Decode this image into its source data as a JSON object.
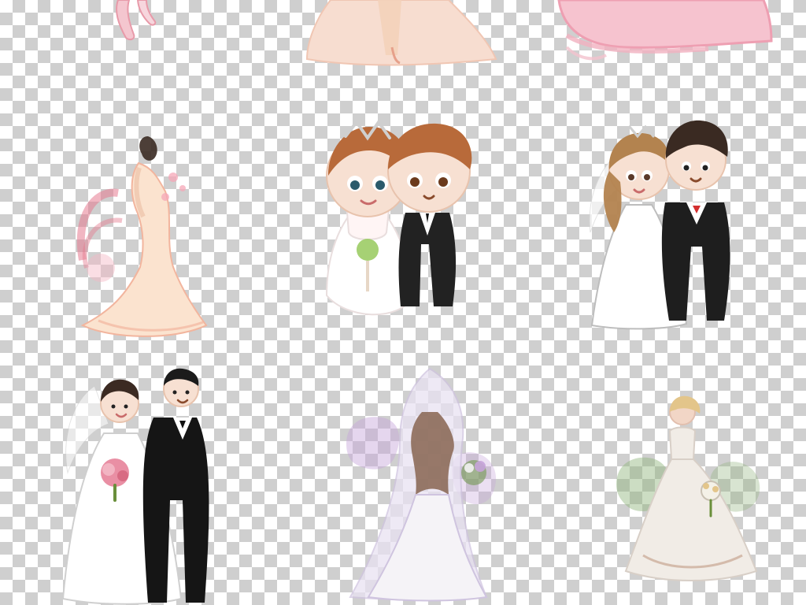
{
  "image": {
    "kind": "clipart-collage",
    "background": "transparency-checkerboard",
    "checker_colors": [
      "#ffffff",
      "#cfcfcf"
    ],
    "rows": 3,
    "figures": [
      {
        "id": "top-left-pink-ribbon-fragment",
        "style": "illustration",
        "palette": [
          "#f4c6cf",
          "#e89aa9"
        ]
      },
      {
        "id": "top-center-peach-gown-fragment",
        "style": "illustration",
        "palette": [
          "#f7ddd0",
          "#f0c6b3"
        ]
      },
      {
        "id": "top-right-pink-ruffle-fragment",
        "style": "illustration",
        "palette": [
          "#f6c3cf",
          "#ee9fb2"
        ]
      },
      {
        "id": "mid-left-bride-peach-gown",
        "style": "illustration",
        "palette": [
          "#fbe3cf",
          "#f2b59e",
          "#e57a8f"
        ]
      },
      {
        "id": "mid-center-chibi-couple",
        "style": "cartoon",
        "palette": [
          "#b86a3a",
          "#ffffff",
          "#222222",
          "#9ccc65"
        ]
      },
      {
        "id": "mid-right-chibi-couple-veil",
        "style": "cartoon",
        "palette": [
          "#b3834f",
          "#ffffff",
          "#1e1e1e",
          "#d32f2f"
        ]
      },
      {
        "id": "bottom-left-bride-groom",
        "style": "illustration",
        "palette": [
          "#3b2a22",
          "#ffffff",
          "#151515",
          "#e7839a"
        ]
      },
      {
        "id": "bottom-center-watercolor-bride-back",
        "style": "watercolor",
        "palette": [
          "#c6a3da",
          "#e9e2f2",
          "#8d6b5a",
          "#7a9b5b"
        ]
      },
      {
        "id": "bottom-right-watercolor-bride-front",
        "style": "watercolor",
        "palette": [
          "#8fb37a",
          "#f1ece6",
          "#e3c58a",
          "#c8a792"
        ]
      }
    ]
  }
}
